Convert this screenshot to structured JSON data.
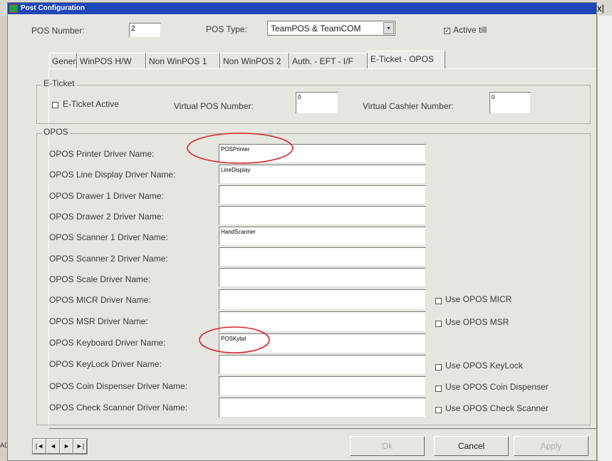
{
  "window": {
    "title": "Post Configuration",
    "close_glyph": "x|"
  },
  "background": {
    "status_text": "ADI",
    "right_text": "x"
  },
  "header": {
    "pos_number_label": "POS Number:",
    "pos_number_value": "2",
    "pos_type_label": "POS Type:",
    "pos_type_value": "TeamPOS & TeamCOM",
    "active_till_label": "Active till",
    "active_till_checked": true
  },
  "tabs": [
    {
      "label": "General",
      "active": false
    },
    {
      "label": "WinPOS H/W",
      "active": false
    },
    {
      "label": "Non WinPOS 1",
      "active": false
    },
    {
      "label": "Non WinPOS 2",
      "active": false
    },
    {
      "label": "Auth. - EFT - I/F",
      "active": false
    },
    {
      "label": "E-Ticket - OPOS",
      "active": true
    }
  ],
  "eticket": {
    "group_title": "E-Ticket",
    "active_label": "E-Ticket Active",
    "active_checked": false,
    "virtual_pos_label": "Virtual POS Number:",
    "virtual_pos_value": "0",
    "virtual_cashier_label": "Virtual Cashier Number:",
    "virtual_cashier_value": "0"
  },
  "opos": {
    "group_title": "OPOS",
    "rows": [
      {
        "label": "OPOS Printer Driver Name:",
        "value": "POSPrinter"
      },
      {
        "label": "OPOS Line Display Driver Name:",
        "value": "LineDisplay"
      },
      {
        "label": "OPOS Drawer 1 Driver Name:",
        "value": ""
      },
      {
        "label": "OPOS Drawer 2 Driver Name:",
        "value": ""
      },
      {
        "label": "OPOS Scanner 1 Driver Name:",
        "value": "HandScanner"
      },
      {
        "label": "OPOS Scanner 2 Driver Name:",
        "value": ""
      },
      {
        "label": "OPOS Scale Driver Name:",
        "value": ""
      },
      {
        "label": "OPOS MICR Driver Name:",
        "value": ""
      },
      {
        "label": "OPOS MSR Driver Name:",
        "value": ""
      },
      {
        "label": "OPOS Keyboard Driver Name:",
        "value": "POSKybd"
      },
      {
        "label": "OPOS KeyLock Driver Name:",
        "value": ""
      },
      {
        "label": "OPOS Coin Dispenser Driver Name:",
        "value": ""
      },
      {
        "label": "OPOS Check Scanner Driver Name:",
        "value": ""
      }
    ],
    "use_options": [
      {
        "label": "Use OPOS MICR",
        "checked": false
      },
      {
        "label": "Use OPOS MSR",
        "checked": false
      },
      {
        "label": "Use OPOS KeyLock",
        "checked": false
      },
      {
        "label": "Use OPOS Coin Dispenser",
        "checked": false
      },
      {
        "label": "Use OPOS Check Scanner",
        "checked": false
      }
    ]
  },
  "navigation": {
    "first": "|◄",
    "prev": "◄",
    "next": "►",
    "last": "►|"
  },
  "buttons": {
    "ok": "Ok",
    "cancel": "Cancel",
    "apply": "Apply"
  },
  "colors": {
    "annotation": "#d8232a",
    "titlebar": "#1e46b8"
  }
}
